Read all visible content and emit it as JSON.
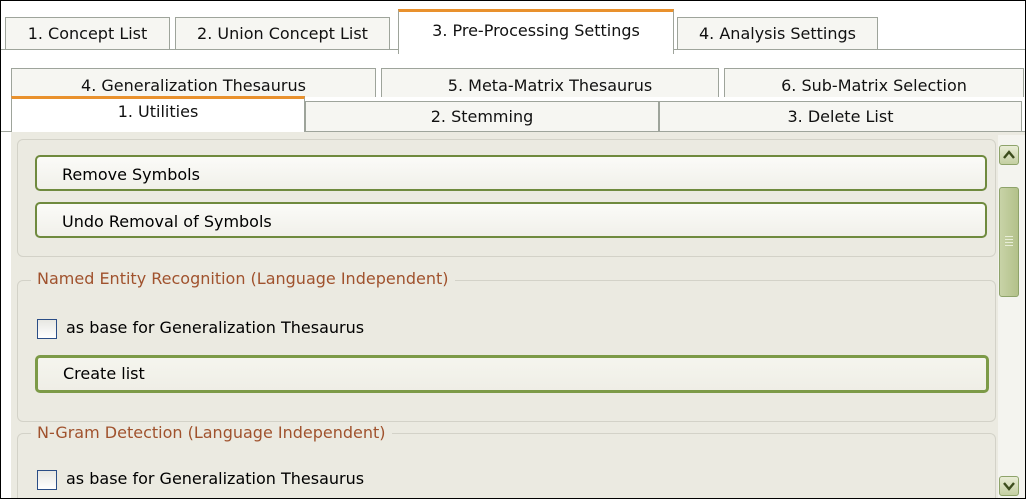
{
  "top_tabs": [
    {
      "label": "1. Concept List",
      "active": false
    },
    {
      "label": "2. Union Concept List",
      "active": false
    },
    {
      "label": "3. Pre-Processing Settings",
      "active": true
    },
    {
      "label": "4. Analysis Settings",
      "active": false
    }
  ],
  "sub_tabs_back": [
    {
      "label": "4. Generalization Thesaurus"
    },
    {
      "label": "5. Meta-Matrix Thesaurus"
    },
    {
      "label": "6. Sub-Matrix Selection"
    }
  ],
  "sub_tabs_front": [
    {
      "label": "1. Utilities",
      "active": true
    },
    {
      "label": "2. Stemming",
      "active": false
    },
    {
      "label": "3. Delete List",
      "active": false
    }
  ],
  "symbols": {
    "remove_label": "Remove Symbols",
    "undo_label": "Undo Removal of Symbols"
  },
  "ner": {
    "title": "Named Entity Recognition (Language Independent)",
    "checkbox_label": "as base for Generalization Thesaurus",
    "checked": false,
    "button_label": "Create list"
  },
  "ngram": {
    "title": "N-Gram Detection (Language Independent)",
    "checkbox_label": "as base for Generalization Thesaurus",
    "checked": false
  },
  "colors": {
    "accent": "#e9912d",
    "button_border": "#6f8a3e",
    "group_title": "#a0522d",
    "panel_bg": "#ebeae1"
  },
  "icons": {
    "scroll_up": "scroll-up-icon",
    "scroll_down": "scroll-down-icon"
  }
}
